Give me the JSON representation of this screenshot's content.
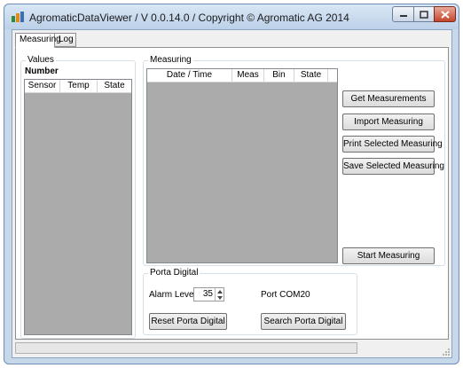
{
  "window": {
    "title": "AgromaticDataViewer / V 0.0.14.0 / Copyright © Agromatic AG 2014"
  },
  "tabs": [
    {
      "label": "Measuring",
      "active": true
    },
    {
      "label": "Log",
      "active": false
    }
  ],
  "values_group": {
    "label": "Values",
    "number_label": "Number",
    "columns": [
      "Sensor",
      "Temp",
      "State"
    ]
  },
  "measuring_group": {
    "label": "Measuring",
    "columns": [
      "Date / Time",
      "Meas",
      "Bin",
      "State"
    ]
  },
  "buttons": {
    "get_measurements": "Get Measurements",
    "import_measuring": "Import Measuring",
    "print_selected": "Print Selected Measuring",
    "save_selected": "Save Selected Measuring",
    "start_measuring": "Start Measuring"
  },
  "porta_digital": {
    "label": "Porta Digital",
    "alarm_level_label": "Alarm Level",
    "alarm_level_value": "35",
    "port_label": "Port COM20",
    "reset_button": "Reset Porta Digital",
    "search_button": "Search Porta Digital"
  },
  "colors": {
    "titlebar": "#c7d8ea",
    "list_bg": "#ababab",
    "close": "#c4452c"
  }
}
